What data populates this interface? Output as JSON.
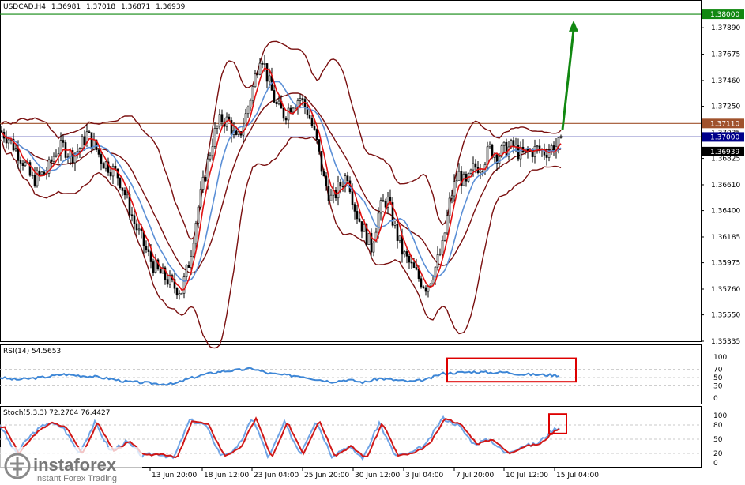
{
  "header": {
    "symbol": "USDCAD,H4",
    "open": "1.36981",
    "high": "1.37018",
    "low": "1.36871",
    "close": "1.36939"
  },
  "price_scale": {
    "ticks": [
      "1.37890",
      "1.37675",
      "1.37460",
      "1.37250",
      "1.37035",
      "1.36825",
      "1.36610",
      "1.36400",
      "1.36185",
      "1.35975",
      "1.35760",
      "1.35550",
      "1.35335"
    ],
    "ylim": [
      1.35335,
      1.3811
    ]
  },
  "price_tags": [
    {
      "label": "1.38000",
      "value": 1.38,
      "color": "#118811"
    },
    {
      "label": "1.37110",
      "value": 1.3711,
      "color": "#a0522d"
    },
    {
      "label": "1.37000",
      "value": 1.37,
      "color": "#00008b"
    },
    {
      "label": "1.36939",
      "value": 1.36939,
      "color": "#000000"
    }
  ],
  "levels": [
    {
      "value": 1.38,
      "color": "#118811"
    },
    {
      "value": 1.3711,
      "color": "#a0522d"
    },
    {
      "value": 1.37,
      "color": "#00008b"
    }
  ],
  "time_labels": [
    "13 Jun 20:00",
    "18 Jun 12:00",
    "23 Jun 04:00",
    "25 Jun 20:00",
    "30 Jun 12:00",
    "3 Jul 04:00",
    "7 Jul 20:00",
    "10 Jul 12:00",
    "15 Jul 04:00"
  ],
  "rsi": {
    "title": "RSI(14) 54.5653",
    "scale": [
      "100",
      "70",
      "50",
      "30",
      "0"
    ],
    "levels": [
      70,
      50,
      30
    ]
  },
  "stoch": {
    "title": "Stoch(5,3,3) 72.2704 76.4427",
    "scale": [
      "100",
      "80",
      "50",
      "20",
      "0"
    ],
    "levels": [
      80,
      50,
      20
    ]
  },
  "forecast_arrow": {
    "from": 1.3706,
    "to": 1.3795,
    "color": "#118811"
  },
  "highlight_color": "#dd0000",
  "logo": {
    "brand": "instaforex",
    "tagline": "Instant Forex Trading"
  },
  "chart_data": {
    "type": "line",
    "title": "USDCAD,H4",
    "price_anchors": [
      [
        0,
        1.3705
      ],
      [
        10,
        1.37
      ],
      [
        20,
        1.369
      ],
      [
        30,
        1.368
      ],
      [
        40,
        1.3665
      ],
      [
        50,
        1.3668
      ],
      [
        60,
        1.3672
      ],
      [
        70,
        1.3688
      ],
      [
        80,
        1.3692
      ],
      [
        90,
        1.3685
      ],
      [
        100,
        1.369
      ],
      [
        110,
        1.3702
      ],
      [
        120,
        1.3692
      ],
      [
        130,
        1.368
      ],
      [
        140,
        1.3675
      ],
      [
        150,
        1.3668
      ],
      [
        160,
        1.365
      ],
      [
        170,
        1.363
      ],
      [
        180,
        1.3615
      ],
      [
        190,
        1.36
      ],
      [
        200,
        1.359
      ],
      [
        210,
        1.3585
      ],
      [
        220,
        1.3578
      ],
      [
        230,
        1.3575
      ],
      [
        240,
        1.36
      ],
      [
        250,
        1.364
      ],
      [
        260,
        1.367
      ],
      [
        270,
        1.37
      ],
      [
        280,
        1.3715
      ],
      [
        290,
        1.3712
      ],
      [
        300,
        1.3695
      ],
      [
        310,
        1.3715
      ],
      [
        320,
        1.374
      ],
      [
        330,
        1.377
      ],
      [
        340,
        1.3745
      ],
      [
        350,
        1.3725
      ],
      [
        360,
        1.3718
      ],
      [
        370,
        1.3728
      ],
      [
        380,
        1.3732
      ],
      [
        390,
        1.372
      ],
      [
        400,
        1.3698
      ],
      [
        410,
        1.3665
      ],
      [
        420,
        1.3648
      ],
      [
        430,
        1.366
      ],
      [
        440,
        1.367
      ],
      [
        450,
        1.364
      ],
      [
        460,
        1.3625
      ],
      [
        470,
        1.361
      ],
      [
        480,
        1.364
      ],
      [
        490,
        1.365
      ],
      [
        500,
        1.3625
      ],
      [
        510,
        1.3605
      ],
      [
        520,
        1.3595
      ],
      [
        530,
        1.3585
      ],
      [
        540,
        1.3578
      ],
      [
        550,
        1.3592
      ],
      [
        560,
        1.361
      ],
      [
        570,
        1.365
      ],
      [
        580,
        1.367
      ],
      [
        590,
        1.366
      ],
      [
        600,
        1.3675
      ],
      [
        610,
        1.3678
      ],
      [
        620,
        1.369
      ],
      [
        630,
        1.3685
      ],
      [
        640,
        1.369
      ],
      [
        650,
        1.3692
      ],
      [
        660,
        1.3685
      ],
      [
        670,
        1.3688
      ],
      [
        680,
        1.369
      ],
      [
        690,
        1.3688
      ],
      [
        700,
        1.3692
      ],
      [
        710,
        1.3694
      ]
    ],
    "rsi_anchors": [
      [
        0,
        50
      ],
      [
        20,
        45
      ],
      [
        40,
        48
      ],
      [
        60,
        52
      ],
      [
        80,
        58
      ],
      [
        100,
        55
      ],
      [
        120,
        52
      ],
      [
        140,
        47
      ],
      [
        160,
        40
      ],
      [
        180,
        38
      ],
      [
        200,
        35
      ],
      [
        220,
        34
      ],
      [
        240,
        48
      ],
      [
        260,
        58
      ],
      [
        280,
        65
      ],
      [
        300,
        68
      ],
      [
        320,
        72
      ],
      [
        340,
        60
      ],
      [
        360,
        56
      ],
      [
        380,
        54
      ],
      [
        400,
        46
      ],
      [
        420,
        40
      ],
      [
        440,
        45
      ],
      [
        460,
        38
      ],
      [
        480,
        48
      ],
      [
        500,
        44
      ],
      [
        520,
        40
      ],
      [
        540,
        45
      ],
      [
        560,
        60
      ],
      [
        580,
        62
      ],
      [
        600,
        64
      ],
      [
        620,
        62
      ],
      [
        640,
        63
      ],
      [
        660,
        58
      ],
      [
        680,
        57
      ],
      [
        700,
        56
      ],
      [
        710,
        55
      ]
    ],
    "stoch_anchors": [
      [
        0,
        80
      ],
      [
        20,
        20
      ],
      [
        40,
        60
      ],
      [
        60,
        85
      ],
      [
        80,
        75
      ],
      [
        100,
        20
      ],
      [
        120,
        85
      ],
      [
        140,
        25
      ],
      [
        160,
        45
      ],
      [
        180,
        15
      ],
      [
        200,
        20
      ],
      [
        220,
        10
      ],
      [
        240,
        90
      ],
      [
        260,
        80
      ],
      [
        280,
        15
      ],
      [
        300,
        30
      ],
      [
        320,
        95
      ],
      [
        340,
        10
      ],
      [
        360,
        85
      ],
      [
        380,
        20
      ],
      [
        400,
        90
      ],
      [
        420,
        15
      ],
      [
        440,
        35
      ],
      [
        460,
        10
      ],
      [
        480,
        85
      ],
      [
        500,
        15
      ],
      [
        520,
        20
      ],
      [
        540,
        40
      ],
      [
        560,
        95
      ],
      [
        580,
        80
      ],
      [
        600,
        40
      ],
      [
        620,
        50
      ],
      [
        640,
        20
      ],
      [
        660,
        35
      ],
      [
        680,
        40
      ],
      [
        700,
        70
      ],
      [
        710,
        76
      ]
    ]
  }
}
